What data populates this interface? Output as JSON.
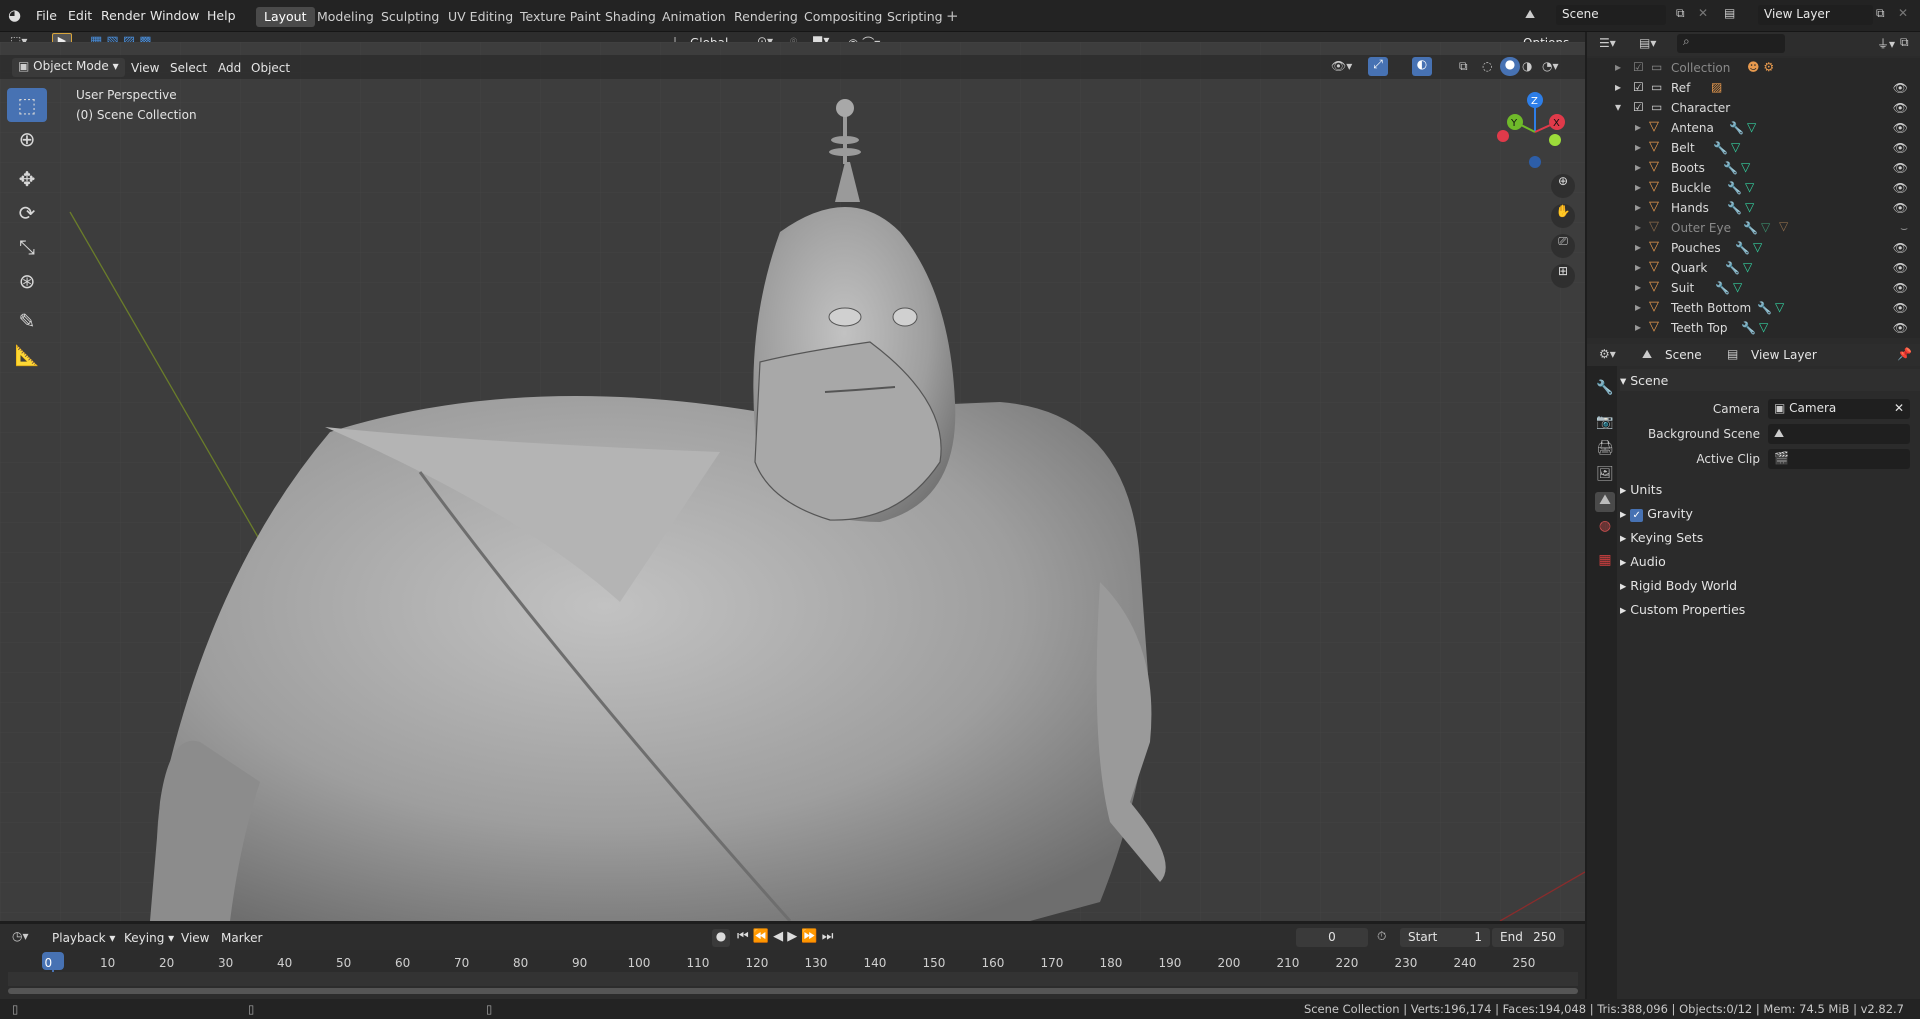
{
  "topmenu": [
    "File",
    "Edit",
    "Render",
    "Window",
    "Help"
  ],
  "workspaces": [
    "Layout",
    "Modeling",
    "Sculpting",
    "UV Editing",
    "Texture Paint",
    "Shading",
    "Animation",
    "Rendering",
    "Compositing",
    "Scripting"
  ],
  "scene_name": "Scene",
  "view_layer": "View Layer",
  "viewport": {
    "mode": "Object Mode",
    "menus": [
      "View",
      "Select",
      "Add",
      "Object"
    ],
    "transform": "Global",
    "options": "Options",
    "overlay_title": "User Perspective",
    "overlay_sub": "(0) Scene Collection",
    "gizmo": {
      "z": "Z",
      "y": "Y",
      "x": "X"
    }
  },
  "outliner": {
    "items": [
      {
        "label": "Collection",
        "dim": true
      },
      {
        "label": "Ref"
      },
      {
        "label": "Character"
      },
      {
        "label": "Antena"
      },
      {
        "label": "Belt"
      },
      {
        "label": "Boots"
      },
      {
        "label": "Buckle"
      },
      {
        "label": "Hands"
      },
      {
        "label": "Outer Eye",
        "dim": true
      },
      {
        "label": "Pouches"
      },
      {
        "label": "Quark"
      },
      {
        "label": "Suit"
      },
      {
        "label": "Teeth Bottom"
      },
      {
        "label": "Teeth Top"
      }
    ]
  },
  "properties": {
    "breadcrumb_scene": "Scene",
    "breadcrumb_layer": "View Layer",
    "section": "Scene",
    "camera_label": "Camera",
    "camera_value": "Camera",
    "bg_label": "Background Scene",
    "clip_label": "Active Clip",
    "panels": [
      "Units",
      "Gravity",
      "Keying Sets",
      "Audio",
      "Rigid Body World",
      "Custom Properties"
    ]
  },
  "timeline": {
    "menus": [
      "Playback",
      "Keying",
      "View",
      "Marker"
    ],
    "current_frame": "0",
    "start_label": "Start",
    "start": "1",
    "end_label": "End",
    "end": "250",
    "ticks": [
      "0",
      "10",
      "20",
      "30",
      "40",
      "50",
      "60",
      "70",
      "80",
      "90",
      "100",
      "110",
      "120",
      "130",
      "140",
      "150",
      "160",
      "170",
      "180",
      "190",
      "200",
      "210",
      "220",
      "230",
      "240",
      "250"
    ]
  },
  "status": "Scene Collection | Verts:196,174 | Faces:194,048 | Tris:388,096 | Objects:0/12 | Mem: 74.5 MiB | v2.82.7"
}
